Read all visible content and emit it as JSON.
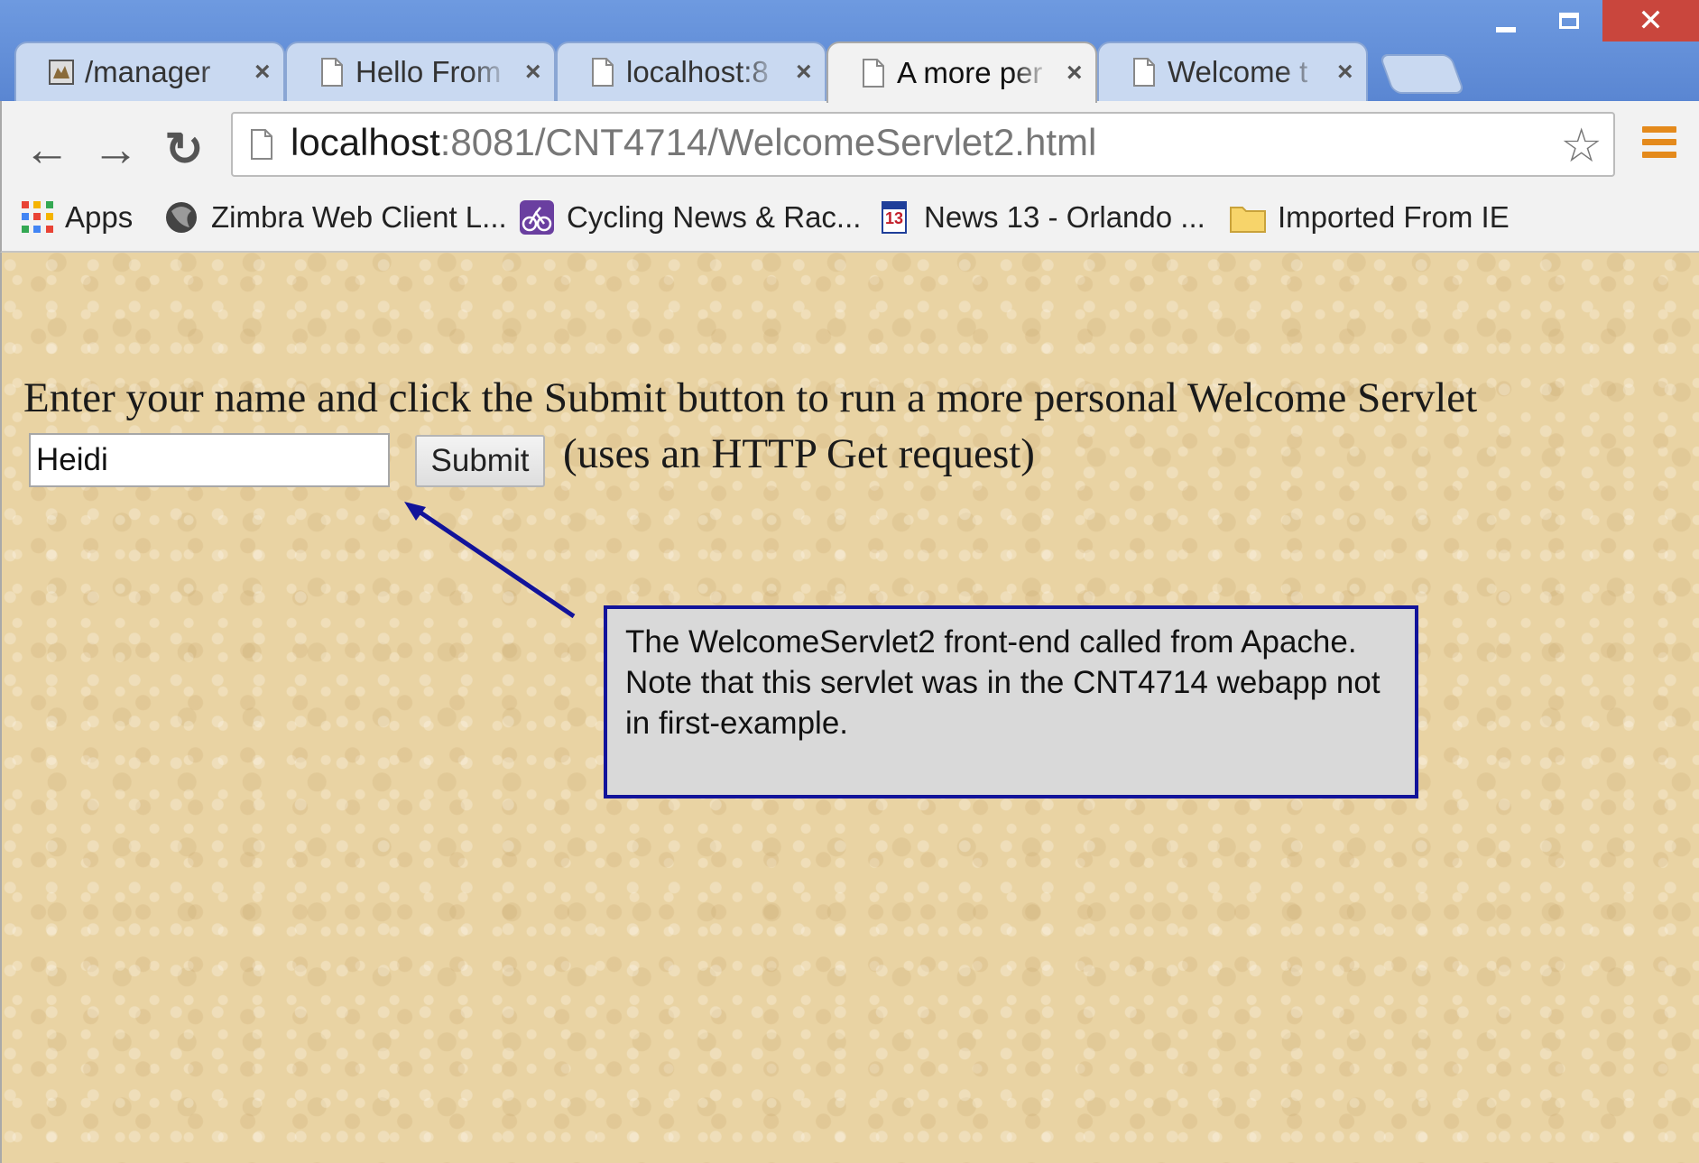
{
  "window": {
    "controls": {
      "minimize_icon": "minimize-icon",
      "maximize_icon": "maximize-icon",
      "close_icon": "close-icon",
      "close_glyph": "✕"
    }
  },
  "tabs": [
    {
      "title": "/manager",
      "icon": "tomcat-icon",
      "close": "×",
      "active": false
    },
    {
      "title": "Hello From",
      "icon": "page-icon",
      "close": "×",
      "active": false
    },
    {
      "title": "localhost:8",
      "icon": "page-icon",
      "close": "×",
      "active": false
    },
    {
      "title": "A more per",
      "icon": "page-icon",
      "close": "×",
      "active": true
    },
    {
      "title": "Welcome t",
      "icon": "page-icon",
      "close": "×",
      "active": false
    }
  ],
  "toolbar": {
    "back_glyph": "←",
    "forward_glyph": "→",
    "reload_glyph": "↻",
    "url_host": "localhost",
    "url_path": ":8081/CNT4714/WelcomeServlet2.html",
    "star_glyph": "☆"
  },
  "bookmarks": [
    {
      "label": "Apps",
      "icon": "apps-grid-icon"
    },
    {
      "label": "Zimbra Web Client L...",
      "icon": "zimbra-icon"
    },
    {
      "label": "Cycling News & Rac...",
      "icon": "cycling-icon"
    },
    {
      "label": "News 13 - Orlando ...",
      "icon": "news13-icon"
    },
    {
      "label": "Imported From IE",
      "icon": "folder-icon"
    }
  ],
  "page": {
    "prompt": "Enter your name and click the Submit button to run a more personal Welcome Servlet",
    "name_value": "Heidi",
    "submit_label": "Submit",
    "hint": "(uses an HTTP Get request)"
  },
  "callout": {
    "text": "The WelcomeServlet2 front-end called from Apache.  Note that this servlet was in the CNT4714 webapp not in first-example.",
    "border_color": "#12139a"
  },
  "colors": {
    "accent_orange": "#e48a1c",
    "titlebar_blue": "#5b8ad6",
    "close_red": "#c9463d"
  }
}
